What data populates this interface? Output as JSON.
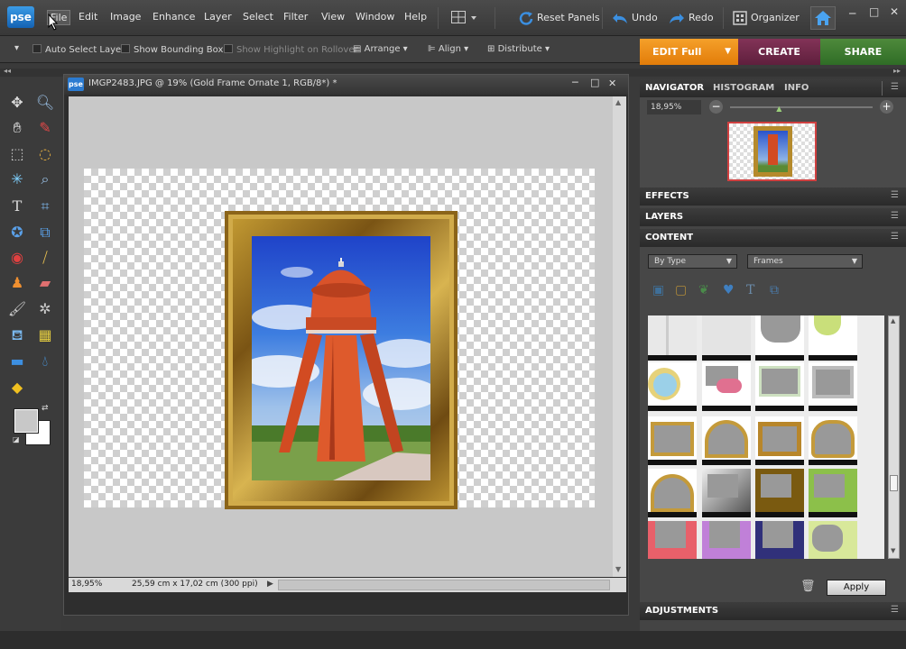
{
  "app": {
    "logo": "pse"
  },
  "menu": {
    "items": [
      "File",
      "Edit",
      "Image",
      "Enhance",
      "Layer",
      "Select",
      "Filter",
      "View",
      "Window",
      "Help"
    ],
    "reset_panels": "Reset Panels",
    "undo": "Undo",
    "redo": "Redo",
    "organizer": "Organizer"
  },
  "options": {
    "auto_select_layer": "Auto Select Layer",
    "show_bounding_box": "Show Bounding Box",
    "show_highlight": "Show Highlight on Rollover",
    "arrange": "Arrange",
    "align": "Align",
    "distribute": "Distribute"
  },
  "mode_tabs": {
    "edit": "EDIT Full",
    "create": "CREATE",
    "share": "SHARE"
  },
  "document": {
    "title": "IMGP2483.JPG @ 19% (Gold Frame Ornate 1, RGB/8*) *",
    "zoom": "18,95%",
    "dimensions": "25,59 cm x 17,02 cm (300 ppi)"
  },
  "navigator": {
    "tabs": [
      "NAVIGATOR",
      "HISTOGRAM",
      "INFO"
    ],
    "zoom": "18,95%",
    "zoom_level": 0.35
  },
  "panels": {
    "effects": "EFFECTS",
    "layers": "LAYERS",
    "content": "CONTENT",
    "adjustments": "ADJUSTMENTS"
  },
  "content": {
    "filter_by": "By Type",
    "type": "Frames",
    "apply": "Apply"
  },
  "colors": {
    "edit_tab": "#f08c17",
    "create_tab": "#6e2748",
    "share_tab": "#3a7a2f",
    "foreground": "#c8c8c8",
    "background": "#ffffff"
  }
}
